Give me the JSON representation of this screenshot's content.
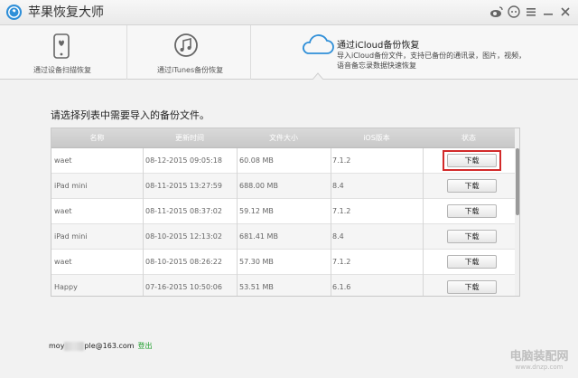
{
  "app": {
    "title": "苹果恢复大师"
  },
  "modes": [
    {
      "label": "通过设备扫描恢复"
    },
    {
      "label": "通过iTunes备份恢复"
    },
    {
      "title": "通过iCloud备份恢复",
      "description": "导入iCloud备份文件，支持已备份的通讯录，图片，视频，语音备忘录数据快速恢复"
    }
  ],
  "prompt": "请选择列表中需要导入的备份文件。",
  "table": {
    "headers": [
      "名称",
      "更新时间",
      "文件大小",
      "iOS版本",
      "状态"
    ],
    "rows": [
      {
        "name": "waet",
        "time": "08-12-2015 09:05:18",
        "size": "60.08 MB",
        "ios": "7.1.2",
        "action": "下载"
      },
      {
        "name": "iPad mini",
        "time": "08-11-2015 13:27:59",
        "size": "688.00 MB",
        "ios": "8.4",
        "action": "下载"
      },
      {
        "name": "waet",
        "time": "08-11-2015 08:37:02",
        "size": "59.12 MB",
        "ios": "7.1.2",
        "action": "下载"
      },
      {
        "name": "iPad mini",
        "time": "08-10-2015 12:13:02",
        "size": "681.41 MB",
        "ios": "8.4",
        "action": "下载"
      },
      {
        "name": "waet",
        "time": "08-10-2015 08:26:22",
        "size": "57.30 MB",
        "ios": "7.1.2",
        "action": "下载"
      },
      {
        "name": "Happy",
        "time": "07-16-2015 10:50:06",
        "size": "53.51 MB",
        "ios": "6.1.6",
        "action": "下载"
      }
    ]
  },
  "account": {
    "prefix": "moy",
    "suffix": "ple@163.com",
    "logout": "登出"
  },
  "watermark": {
    "line1": "电脑装配网",
    "line2": "www.dnzp.com"
  },
  "colors": {
    "highlight": "#d22a2a",
    "logout": "#1f9e2c",
    "icloud": "#2f8fd8"
  }
}
